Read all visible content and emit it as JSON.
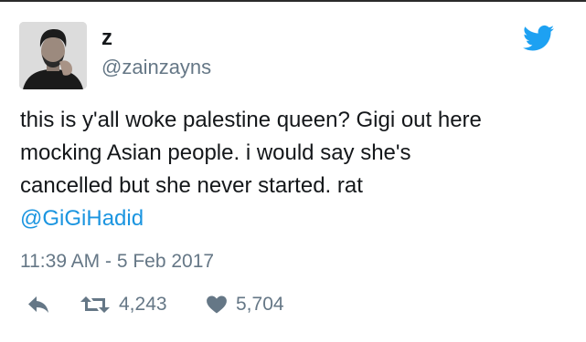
{
  "colors": {
    "text": "#14171a",
    "secondary": "#657786",
    "accent": "#1b95e0",
    "bird": "#1da1f2"
  },
  "user": {
    "name": "z",
    "handle": "@zainzayns",
    "avatar_icon": "profile-photo"
  },
  "brand_icon": "twitter-bird-icon",
  "tweet": {
    "lines": [
      "this is y'all woke palestine queen? Gigi out here",
      "mocking Asian people. i would say she's",
      "cancelled but she never started. rat"
    ],
    "mention": "@GiGiHadid",
    "timestamp": "11:39 AM - 5 Feb 2017"
  },
  "actions": {
    "reply_icon": "reply-icon",
    "retweet_icon": "retweet-icon",
    "retweet_count": "4,243",
    "like_icon": "heart-icon",
    "like_count": "5,704"
  }
}
